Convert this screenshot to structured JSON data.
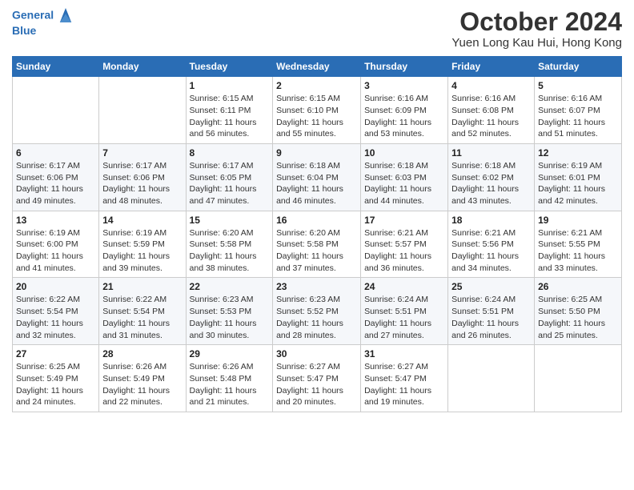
{
  "header": {
    "logo_line1": "General",
    "logo_line2": "Blue",
    "month": "October 2024",
    "location": "Yuen Long Kau Hui, Hong Kong"
  },
  "weekdays": [
    "Sunday",
    "Monday",
    "Tuesday",
    "Wednesday",
    "Thursday",
    "Friday",
    "Saturday"
  ],
  "weeks": [
    [
      {
        "day": "",
        "sunrise": "",
        "sunset": "",
        "daylight": ""
      },
      {
        "day": "",
        "sunrise": "",
        "sunset": "",
        "daylight": ""
      },
      {
        "day": "1",
        "sunrise": "Sunrise: 6:15 AM",
        "sunset": "Sunset: 6:11 PM",
        "daylight": "Daylight: 11 hours and 56 minutes."
      },
      {
        "day": "2",
        "sunrise": "Sunrise: 6:15 AM",
        "sunset": "Sunset: 6:10 PM",
        "daylight": "Daylight: 11 hours and 55 minutes."
      },
      {
        "day": "3",
        "sunrise": "Sunrise: 6:16 AM",
        "sunset": "Sunset: 6:09 PM",
        "daylight": "Daylight: 11 hours and 53 minutes."
      },
      {
        "day": "4",
        "sunrise": "Sunrise: 6:16 AM",
        "sunset": "Sunset: 6:08 PM",
        "daylight": "Daylight: 11 hours and 52 minutes."
      },
      {
        "day": "5",
        "sunrise": "Sunrise: 6:16 AM",
        "sunset": "Sunset: 6:07 PM",
        "daylight": "Daylight: 11 hours and 51 minutes."
      }
    ],
    [
      {
        "day": "6",
        "sunrise": "Sunrise: 6:17 AM",
        "sunset": "Sunset: 6:06 PM",
        "daylight": "Daylight: 11 hours and 49 minutes."
      },
      {
        "day": "7",
        "sunrise": "Sunrise: 6:17 AM",
        "sunset": "Sunset: 6:06 PM",
        "daylight": "Daylight: 11 hours and 48 minutes."
      },
      {
        "day": "8",
        "sunrise": "Sunrise: 6:17 AM",
        "sunset": "Sunset: 6:05 PM",
        "daylight": "Daylight: 11 hours and 47 minutes."
      },
      {
        "day": "9",
        "sunrise": "Sunrise: 6:18 AM",
        "sunset": "Sunset: 6:04 PM",
        "daylight": "Daylight: 11 hours and 46 minutes."
      },
      {
        "day": "10",
        "sunrise": "Sunrise: 6:18 AM",
        "sunset": "Sunset: 6:03 PM",
        "daylight": "Daylight: 11 hours and 44 minutes."
      },
      {
        "day": "11",
        "sunrise": "Sunrise: 6:18 AM",
        "sunset": "Sunset: 6:02 PM",
        "daylight": "Daylight: 11 hours and 43 minutes."
      },
      {
        "day": "12",
        "sunrise": "Sunrise: 6:19 AM",
        "sunset": "Sunset: 6:01 PM",
        "daylight": "Daylight: 11 hours and 42 minutes."
      }
    ],
    [
      {
        "day": "13",
        "sunrise": "Sunrise: 6:19 AM",
        "sunset": "Sunset: 6:00 PM",
        "daylight": "Daylight: 11 hours and 41 minutes."
      },
      {
        "day": "14",
        "sunrise": "Sunrise: 6:19 AM",
        "sunset": "Sunset: 5:59 PM",
        "daylight": "Daylight: 11 hours and 39 minutes."
      },
      {
        "day": "15",
        "sunrise": "Sunrise: 6:20 AM",
        "sunset": "Sunset: 5:58 PM",
        "daylight": "Daylight: 11 hours and 38 minutes."
      },
      {
        "day": "16",
        "sunrise": "Sunrise: 6:20 AM",
        "sunset": "Sunset: 5:58 PM",
        "daylight": "Daylight: 11 hours and 37 minutes."
      },
      {
        "day": "17",
        "sunrise": "Sunrise: 6:21 AM",
        "sunset": "Sunset: 5:57 PM",
        "daylight": "Daylight: 11 hours and 36 minutes."
      },
      {
        "day": "18",
        "sunrise": "Sunrise: 6:21 AM",
        "sunset": "Sunset: 5:56 PM",
        "daylight": "Daylight: 11 hours and 34 minutes."
      },
      {
        "day": "19",
        "sunrise": "Sunrise: 6:21 AM",
        "sunset": "Sunset: 5:55 PM",
        "daylight": "Daylight: 11 hours and 33 minutes."
      }
    ],
    [
      {
        "day": "20",
        "sunrise": "Sunrise: 6:22 AM",
        "sunset": "Sunset: 5:54 PM",
        "daylight": "Daylight: 11 hours and 32 minutes."
      },
      {
        "day": "21",
        "sunrise": "Sunrise: 6:22 AM",
        "sunset": "Sunset: 5:54 PM",
        "daylight": "Daylight: 11 hours and 31 minutes."
      },
      {
        "day": "22",
        "sunrise": "Sunrise: 6:23 AM",
        "sunset": "Sunset: 5:53 PM",
        "daylight": "Daylight: 11 hours and 30 minutes."
      },
      {
        "day": "23",
        "sunrise": "Sunrise: 6:23 AM",
        "sunset": "Sunset: 5:52 PM",
        "daylight": "Daylight: 11 hours and 28 minutes."
      },
      {
        "day": "24",
        "sunrise": "Sunrise: 6:24 AM",
        "sunset": "Sunset: 5:51 PM",
        "daylight": "Daylight: 11 hours and 27 minutes."
      },
      {
        "day": "25",
        "sunrise": "Sunrise: 6:24 AM",
        "sunset": "Sunset: 5:51 PM",
        "daylight": "Daylight: 11 hours and 26 minutes."
      },
      {
        "day": "26",
        "sunrise": "Sunrise: 6:25 AM",
        "sunset": "Sunset: 5:50 PM",
        "daylight": "Daylight: 11 hours and 25 minutes."
      }
    ],
    [
      {
        "day": "27",
        "sunrise": "Sunrise: 6:25 AM",
        "sunset": "Sunset: 5:49 PM",
        "daylight": "Daylight: 11 hours and 24 minutes."
      },
      {
        "day": "28",
        "sunrise": "Sunrise: 6:26 AM",
        "sunset": "Sunset: 5:49 PM",
        "daylight": "Daylight: 11 hours and 22 minutes."
      },
      {
        "day": "29",
        "sunrise": "Sunrise: 6:26 AM",
        "sunset": "Sunset: 5:48 PM",
        "daylight": "Daylight: 11 hours and 21 minutes."
      },
      {
        "day": "30",
        "sunrise": "Sunrise: 6:27 AM",
        "sunset": "Sunset: 5:47 PM",
        "daylight": "Daylight: 11 hours and 20 minutes."
      },
      {
        "day": "31",
        "sunrise": "Sunrise: 6:27 AM",
        "sunset": "Sunset: 5:47 PM",
        "daylight": "Daylight: 11 hours and 19 minutes."
      },
      {
        "day": "",
        "sunrise": "",
        "sunset": "",
        "daylight": ""
      },
      {
        "day": "",
        "sunrise": "",
        "sunset": "",
        "daylight": ""
      }
    ]
  ]
}
